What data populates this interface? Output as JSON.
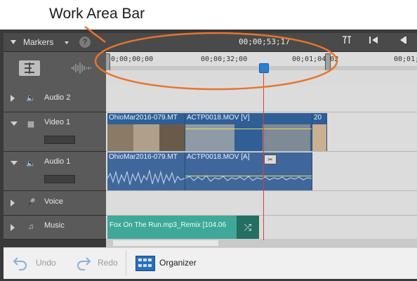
{
  "annotation": {
    "label": "Work Area Bar"
  },
  "toolbar": {
    "markers_label": "Markers",
    "help_label": "?",
    "timecode": "00;00;53;17",
    "buttons": [
      "trim-icon",
      "go-to-start-icon",
      "step-back-icon"
    ]
  },
  "ruler": {
    "timecodes": [
      "0;00;00;00",
      "00;00;32;00",
      "00;01;04;02",
      "00;01;3"
    ]
  },
  "tracks": [
    {
      "name": "Audio 2",
      "type": "audio"
    },
    {
      "name": "Video 1",
      "type": "video"
    },
    {
      "name": "Audio 1",
      "type": "audio"
    },
    {
      "name": "Voice",
      "type": "voice"
    },
    {
      "name": "Music",
      "type": "music"
    }
  ],
  "clips": {
    "video": [
      {
        "label": "OhioMar2016-079.MT"
      },
      {
        "label": "ACTP0018.MOV [V]"
      },
      {
        "label": "20"
      }
    ],
    "audio": [
      {
        "label": "OhioMar2016-079.MT"
      },
      {
        "label": "ACTP0018.MOV [A]"
      }
    ],
    "music": {
      "label": "Fox On The Run.mp3_Remix [104.06"
    }
  },
  "bottom": {
    "undo_label": "Undo",
    "redo_label": "Redo",
    "organizer_label": "Organizer"
  }
}
